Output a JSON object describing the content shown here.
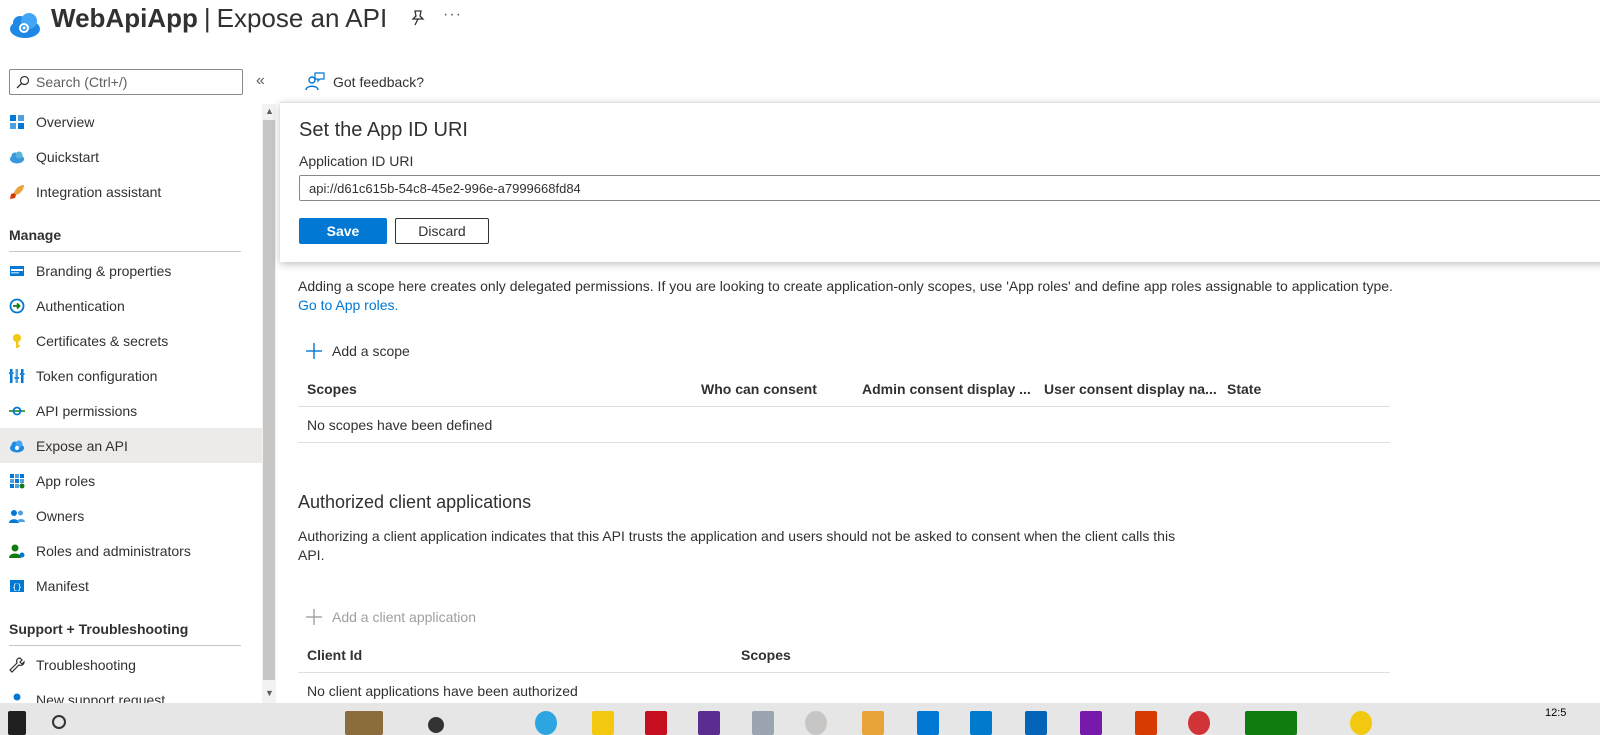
{
  "header": {
    "app_name": "WebApiApp",
    "separator": "|",
    "page_title": "Expose an API",
    "more": "···"
  },
  "sidebar": {
    "search_placeholder": "Search (Ctrl+/)",
    "collapse": "«",
    "items_top": [
      {
        "label": "Overview",
        "icon": "overview-grid-icon"
      },
      {
        "label": "Quickstart",
        "icon": "quickstart-cloud-icon"
      },
      {
        "label": "Integration assistant",
        "icon": "rocket-icon"
      }
    ],
    "section_manage": "Manage",
    "items_manage": [
      {
        "label": "Branding & properties",
        "icon": "branding-icon"
      },
      {
        "label": "Authentication",
        "icon": "authentication-icon"
      },
      {
        "label": "Certificates & secrets",
        "icon": "key-icon"
      },
      {
        "label": "Token configuration",
        "icon": "token-bars-icon"
      },
      {
        "label": "API permissions",
        "icon": "api-permissions-icon"
      },
      {
        "label": "Expose an API",
        "icon": "expose-api-cloud-icon",
        "selected": true
      },
      {
        "label": "App roles",
        "icon": "app-roles-grid-icon"
      },
      {
        "label": "Owners",
        "icon": "owners-people-icon"
      },
      {
        "label": "Roles and administrators",
        "icon": "roles-admin-icon"
      },
      {
        "label": "Manifest",
        "icon": "manifest-icon"
      }
    ],
    "section_support": "Support + Troubleshooting",
    "items_support": [
      {
        "label": "Troubleshooting",
        "icon": "wrench-icon"
      },
      {
        "label": "New support request",
        "icon": "support-person-icon"
      }
    ]
  },
  "commandbar": {
    "feedback_label": "Got feedback?"
  },
  "panel": {
    "title": "Set the App ID URI",
    "field_label": "Application ID URI",
    "field_value": "api://d61c615b-54c8-45e2-996e-a7999668fd84",
    "save_label": "Save",
    "discard_label": "Discard"
  },
  "scopes": {
    "description": "Adding a scope here creates only delegated permissions. If you are looking to create application-only scopes, use 'App roles' and define app roles assignable to application type.",
    "link": "Go to App roles.",
    "add_label": "Add a scope",
    "columns": [
      "Scopes",
      "Who can consent",
      "Admin consent display ...",
      "User consent display na...",
      "State"
    ],
    "empty_text": "No scopes have been defined"
  },
  "clients": {
    "title": "Authorized client applications",
    "description": "Authorizing a client application indicates that this API trusts the application and users should not be asked to consent when the client calls this API.",
    "add_label": "Add a client application",
    "columns": [
      "Client Id",
      "Scopes"
    ],
    "empty_text": "No client applications have been authorized"
  },
  "taskbar": {
    "clock": "12:5"
  },
  "colors": {
    "accent": "#0078d4",
    "selected_bg": "#edebe9",
    "text": "#323130",
    "disabled": "#a19f9d"
  }
}
